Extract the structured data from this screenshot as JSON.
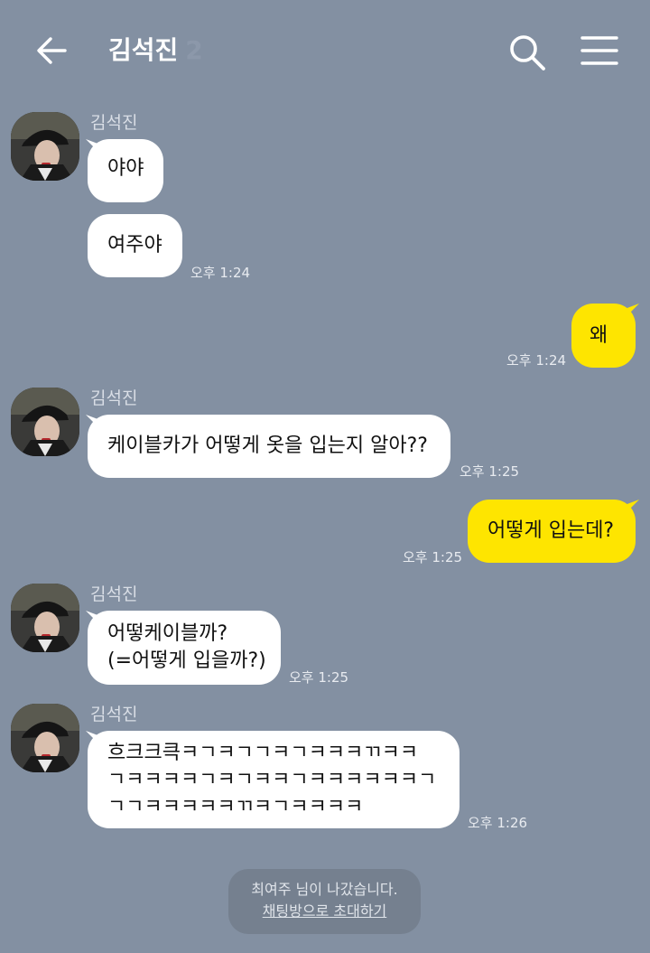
{
  "header": {
    "title": "김석진",
    "member_count": "2",
    "back_icon": "arrow-left-icon",
    "search_icon": "search-icon",
    "menu_icon": "hamburger-menu-icon"
  },
  "messages": [
    {
      "sender": "김석진",
      "text": "야야"
    },
    {
      "text": "여주야",
      "time": "오후 1:24"
    },
    {
      "text": "왜",
      "time": "오후 1:24",
      "outgoing": true
    },
    {
      "sender": "김석진",
      "text": "케이블카가 어떻게 옷을 입는지 알아??",
      "time": "오후 1:25"
    },
    {
      "text": "어떻게 입는데?",
      "time": "오후 1:25",
      "outgoing": true
    },
    {
      "sender": "김석진",
      "lines": [
        "어떻케이블까?",
        "(=어떻게 입을까?)"
      ],
      "time": "오후 1:25"
    },
    {
      "sender": "김석진",
      "lines": [
        "흐크크큭ㅋㄱㅋㄱㄱㅋㄱㅋㅋㅋㄲㅋㅋ",
        "ㄱㅋㅋㅋㅋㄱㅋㄱㅋㅋㄱㅋㅋㅋㅋㅋㅋㄱ",
        "ㄱㄱㅋㅋㅋㅋㅋㄲㅋㄱㅋㅋㅋㅋ"
      ],
      "time": "오후 1:26"
    }
  ],
  "notice": {
    "text": "최여주 님이 나갔습니다.",
    "link": "채팅방으로 초대하기"
  },
  "colors": {
    "background": "#8390a2",
    "incoming_bubble": "#ffffff",
    "outgoing_bubble": "#fee500"
  }
}
